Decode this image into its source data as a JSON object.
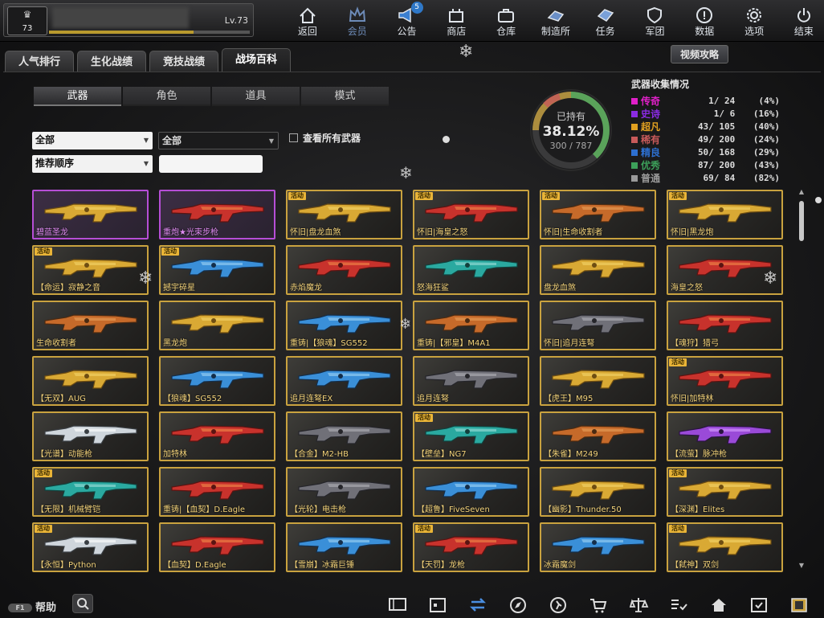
{
  "profile": {
    "level_badge": "73",
    "level_text": "Lv.73",
    "exp_fraction": 0.72
  },
  "nav": [
    {
      "label": "返回",
      "icon": "home-icon"
    },
    {
      "label": "会员",
      "icon": "crown-icon",
      "active": true
    },
    {
      "label": "公告",
      "icon": "megaphone-icon",
      "badge": "5"
    },
    {
      "label": "商店",
      "icon": "shop-icon"
    },
    {
      "label": "仓库",
      "icon": "briefcase-icon"
    },
    {
      "label": "制造所",
      "icon": "forge-icon"
    },
    {
      "label": "任务",
      "icon": "task-icon"
    },
    {
      "label": "军团",
      "icon": "shield-icon"
    },
    {
      "label": "数据",
      "icon": "info-icon"
    },
    {
      "label": "选项",
      "icon": "gear-icon"
    },
    {
      "label": "结束",
      "icon": "power-icon"
    }
  ],
  "tabs": [
    {
      "label": "人气排行"
    },
    {
      "label": "生化战绩"
    },
    {
      "label": "竞技战绩"
    },
    {
      "label": "战场百科",
      "active": true
    }
  ],
  "guide_button": "视频攻略",
  "subtabs": [
    {
      "label": "武器",
      "active": true
    },
    {
      "label": "角色"
    },
    {
      "label": "道具"
    },
    {
      "label": "模式"
    }
  ],
  "filters": {
    "type": "全部",
    "category": "全部",
    "sort": "推荐顺序",
    "show_all_label": "查看所有武器",
    "search_value": ""
  },
  "ring": {
    "label": "已持有",
    "percent": "38.12%",
    "count": "300 / 787",
    "fraction": 0.3812
  },
  "collection": {
    "title": "武器收集情况",
    "rows": [
      {
        "name": "传奇",
        "count": "1/ 24",
        "pct": "(4%)",
        "color": "#e020c8"
      },
      {
        "name": "史诗",
        "count": "1/ 6",
        "pct": "(16%)",
        "color": "#8a2be2"
      },
      {
        "name": "超凡",
        "count": "43/ 105",
        "pct": "(40%)",
        "color": "#e0a020"
      },
      {
        "name": "稀有",
        "count": "49/ 200",
        "pct": "(24%)",
        "color": "#c75a5a"
      },
      {
        "name": "精良",
        "count": "50/ 168",
        "pct": "(29%)",
        "color": "#2d6fd0"
      },
      {
        "name": "优秀",
        "count": "87/ 200",
        "pct": "(43%)",
        "color": "#3da05a"
      },
      {
        "name": "普通",
        "count": "69/ 84",
        "pct": "(82%)",
        "color": "#9a9a9a"
      }
    ]
  },
  "activity_tag": "活动",
  "weapons": [
    {
      "name": "碧蓝圣龙",
      "rare": "purple",
      "tag": false,
      "style": "gold"
    },
    {
      "name": "重炮★光束步枪",
      "rare": "purple",
      "tag": false,
      "style": "red"
    },
    {
      "name": "怀旧|盘龙血煞",
      "tag": true,
      "style": "gold"
    },
    {
      "name": "怀旧|海皇之怒",
      "tag": true,
      "style": "red"
    },
    {
      "name": "怀旧|生命收割者",
      "tag": true,
      "style": "orange"
    },
    {
      "name": "怀旧|黑龙炮",
      "tag": true,
      "style": "gold"
    },
    {
      "name": "【命运】寂静之音",
      "tag": true,
      "style": "gold"
    },
    {
      "name": "撼宇碎星",
      "tag": true,
      "style": "blue"
    },
    {
      "name": "赤焰魔龙",
      "tag": false,
      "style": "red"
    },
    {
      "name": "怒海狂鲨",
      "tag": false,
      "style": "teal"
    },
    {
      "name": "盘龙血煞",
      "tag": false,
      "style": "gold"
    },
    {
      "name": "海皇之怒",
      "tag": false,
      "style": "red"
    },
    {
      "name": "生命收割者",
      "tag": false,
      "style": "orange"
    },
    {
      "name": "黑龙炮",
      "tag": false,
      "style": "gold"
    },
    {
      "name": "重铸|【狼魂】SG552",
      "tag": false,
      "style": "blue"
    },
    {
      "name": "重铸|【邪皇】M4A1",
      "tag": false,
      "style": "orange"
    },
    {
      "name": "怀旧|追月连弩",
      "tag": false,
      "style": "dark"
    },
    {
      "name": "【魂狩】猎弓",
      "tag": false,
      "style": "red"
    },
    {
      "name": "【无双】AUG",
      "tag": false,
      "style": "gold"
    },
    {
      "name": "【狼魂】SG552",
      "tag": false,
      "style": "blue"
    },
    {
      "name": "追月连弩EX",
      "tag": false,
      "style": "blue"
    },
    {
      "name": "追月连弩",
      "tag": false,
      "style": "dark"
    },
    {
      "name": "【虎王】M95",
      "tag": false,
      "style": "gold"
    },
    {
      "name": "怀旧|加特林",
      "tag": true,
      "style": "red"
    },
    {
      "name": "【光谱】动能枪",
      "tag": false,
      "style": "white"
    },
    {
      "name": "加特林",
      "tag": false,
      "style": "red"
    },
    {
      "name": "【合金】M2-HB",
      "tag": false,
      "style": "dark"
    },
    {
      "name": "【壁垒】NG7",
      "tag": true,
      "style": "teal"
    },
    {
      "name": "【朱雀】M249",
      "tag": false,
      "style": "orange"
    },
    {
      "name": "【流萤】脉冲枪",
      "tag": false,
      "style": "purple"
    },
    {
      "name": "【无限】机械臂铠",
      "tag": true,
      "style": "teal"
    },
    {
      "name": "重铸|【血契】D.Eagle",
      "tag": false,
      "style": "red"
    },
    {
      "name": "【光轮】电击枪",
      "tag": false,
      "style": "dark"
    },
    {
      "name": "【超鲁】FiveSeven",
      "tag": false,
      "style": "blue"
    },
    {
      "name": "【幽影】Thunder.50",
      "tag": false,
      "style": "gold"
    },
    {
      "name": "【深渊】Elites",
      "tag": true,
      "style": "gold"
    },
    {
      "name": "【永恒】Python",
      "tag": true,
      "style": "white"
    },
    {
      "name": "【血契】D.Eagle",
      "tag": false,
      "style": "red"
    },
    {
      "name": "【雪崩】冰霜巨锤",
      "tag": false,
      "style": "blue"
    },
    {
      "name": "【天罚】龙枪",
      "tag": true,
      "style": "red"
    },
    {
      "name": "冰霜魔剑",
      "tag": false,
      "style": "blue"
    },
    {
      "name": "【弑神】双剑",
      "tag": true,
      "style": "gold"
    }
  ],
  "help_label": "帮助",
  "help_key": "F1",
  "bottom_icons": [
    "ticket-icon",
    "calendar-icon",
    "swap-icon",
    "compass-icon",
    "runner-icon",
    "cart-icon",
    "scale-icon",
    "checklist-icon",
    "house-icon",
    "calendar-check-icon",
    "film-icon"
  ]
}
